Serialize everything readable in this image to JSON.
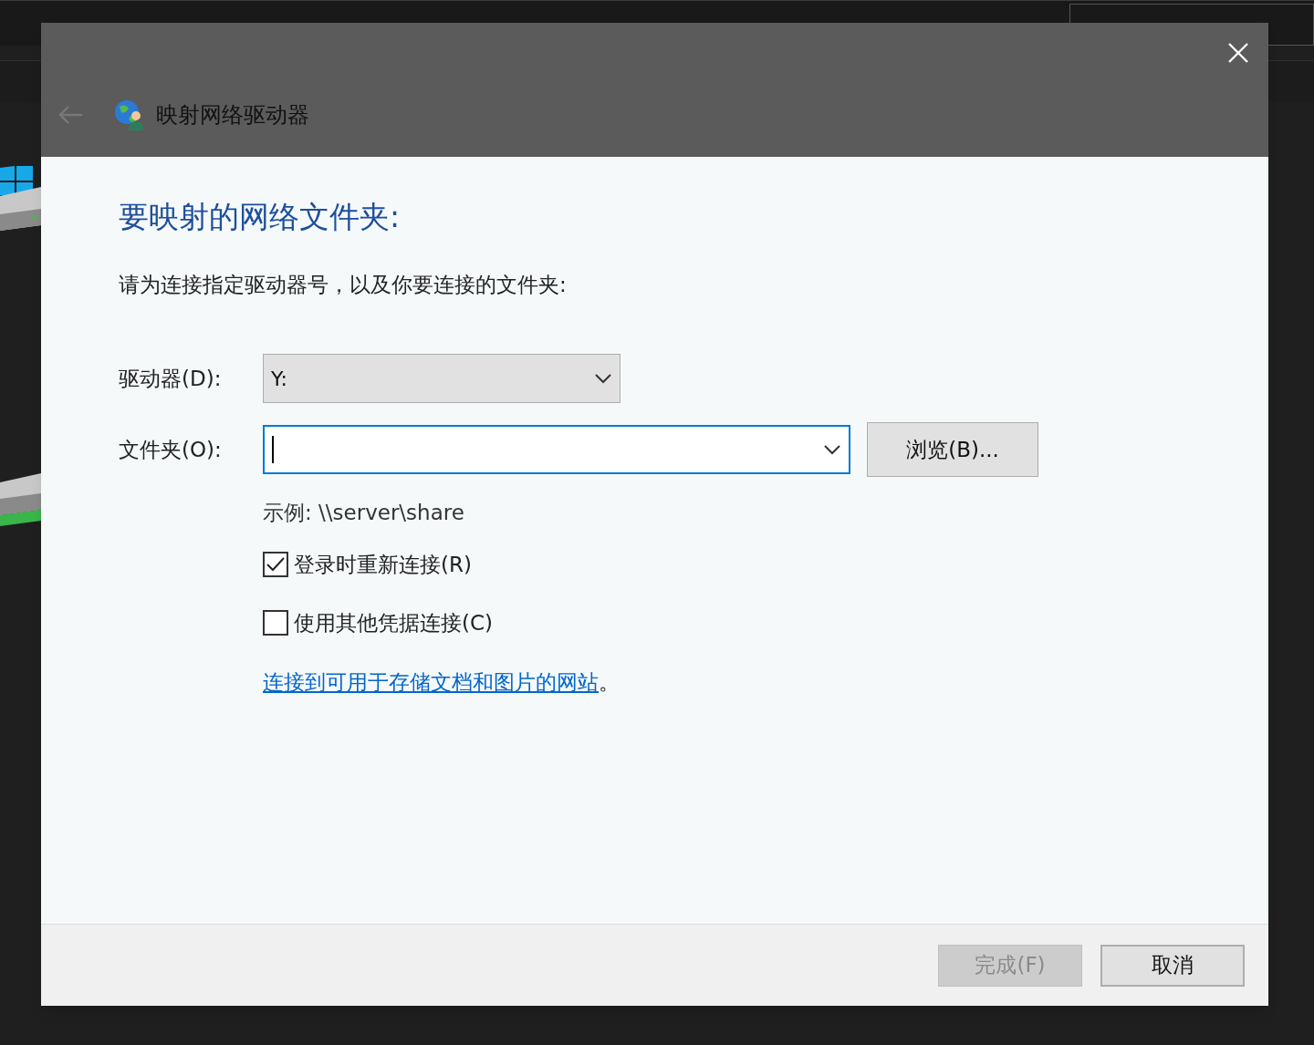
{
  "window": {
    "title": "映射网络驱动器"
  },
  "heading": "要映射的网络文件夹:",
  "instruction": "请为连接指定驱动器号，以及你要连接的文件夹:",
  "drive": {
    "label": "驱动器(D):",
    "value": "Y:"
  },
  "folder": {
    "label": "文件夹(O):",
    "focused": true
  },
  "browse_button": "浏览(B)...",
  "example": "示例: \\\\server\\share",
  "options": [
    {
      "label": "登录时重新连接(R)",
      "checked": true
    },
    {
      "label": "使用其他凭据连接(C)",
      "checked": false
    }
  ],
  "link": {
    "text": "连接到可用于存储文档和图片的网站",
    "suffix": "。"
  },
  "buttons": [
    {
      "label": "完成(F)",
      "disabled": true
    },
    {
      "label": "取消",
      "disabled": false
    }
  ]
}
